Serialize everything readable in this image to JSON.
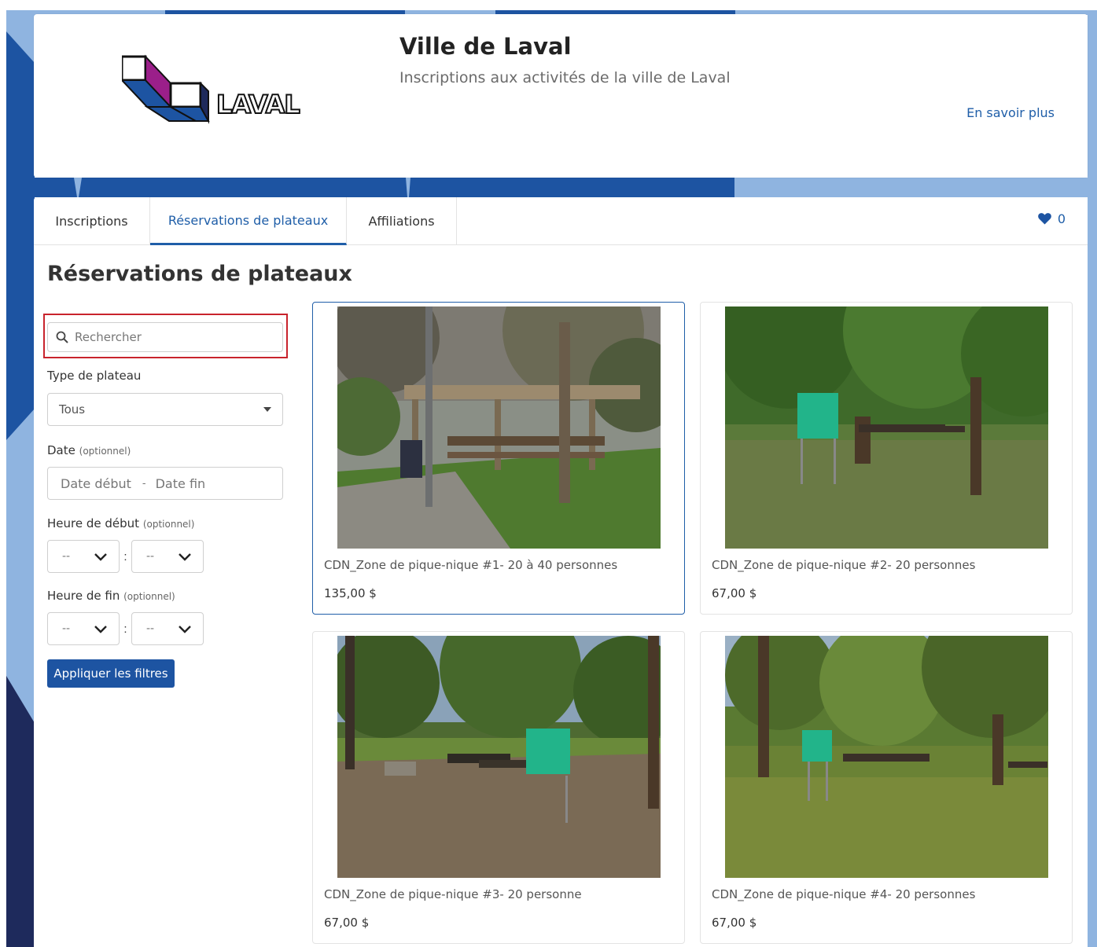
{
  "header": {
    "logo_text": "LAVAL",
    "title": "Ville de Laval",
    "subtitle": "Inscriptions aux activités de la ville de Laval",
    "learn_more": "En savoir plus"
  },
  "tabs": [
    {
      "label": "Inscriptions",
      "active": false
    },
    {
      "label": "Réservations de plateaux",
      "active": true
    },
    {
      "label": "Affiliations",
      "active": false
    }
  ],
  "favorites": {
    "count": "0"
  },
  "page_title": "Réservations de plateaux",
  "filters": {
    "search_placeholder": "Rechercher",
    "type_label": "Type de plateau",
    "type_value": "Tous",
    "date_label": "Date",
    "optional": "(optionnel)",
    "date_start_placeholder": "Date début",
    "date_end_placeholder": "Date fin",
    "start_time_label": "Heure de début",
    "end_time_label": "Heure de fin",
    "time_placeholder": "--",
    "apply_label": "Appliquer les filtres"
  },
  "cards": [
    {
      "name": "CDN_Zone de pique-nique #1- 20 à 40 personnes",
      "price": "135,00 $",
      "selected": true
    },
    {
      "name": "CDN_Zone de pique-nique #2- 20 personnes",
      "price": "67,00 $",
      "selected": false
    },
    {
      "name": "CDN_Zone de pique-nique #3- 20 personne",
      "price": "67,00 $",
      "selected": false
    },
    {
      "name": "CDN_Zone de pique-nique #4- 20 personnes",
      "price": "67,00 $",
      "selected": false
    }
  ],
  "colors": {
    "brand_blue": "#1d54a2",
    "link_blue": "#1f5ea8",
    "highlight_red": "#c8232c",
    "bg_light_blue": "#8fb4e0",
    "bg_dark_navy": "#1e2a5c"
  }
}
